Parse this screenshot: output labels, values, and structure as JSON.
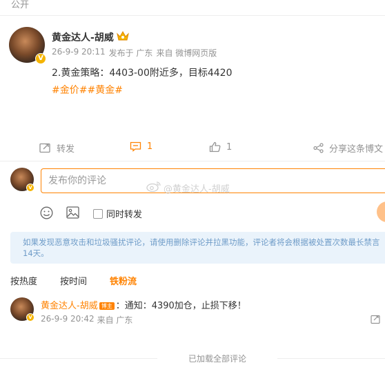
{
  "header": {
    "visibility": "公开"
  },
  "post": {
    "author": "黄金达人-胡威",
    "crown_icon": "crown-icon",
    "date": "26-9-9 20:11",
    "published_in": "发布于 广东",
    "source": "来自 微博网页版",
    "text": "2.黄金策略：4403-00附近多，目标4420",
    "hashtags": "#金价##黄金#",
    "actions": {
      "repost_label": "转发",
      "comment_count": "1",
      "like_count": "1",
      "share_label": "分享这条博文"
    }
  },
  "comment_composer": {
    "placeholder": "发布你的评论",
    "watermark": "@黄金达人-胡威",
    "repost_label": "同时转发"
  },
  "notice": {
    "text": "如果发现恶意攻击和垃圾骚扰评论，请使用删除评论并拉黑功能，评论者将会根据被处置次数最长禁言14天。"
  },
  "sort_tabs": [
    {
      "label": "按热度"
    },
    {
      "label": "按时间"
    },
    {
      "label": "铁粉流"
    }
  ],
  "comment": {
    "author": "黄金达人-胡威",
    "tag": "博主",
    "text": "：通知：4390加仓，止损下移！",
    "date": "26-9-9 20:42",
    "location": "来自 广东"
  },
  "footer": {
    "loaded_text": "已加载全部评论"
  },
  "colors": {
    "accent": "#ff8200",
    "muted": "#939393",
    "notice_bg": "#eaf3fb",
    "notice_text": "#6f9cc8",
    "badge": "#f5b400"
  }
}
